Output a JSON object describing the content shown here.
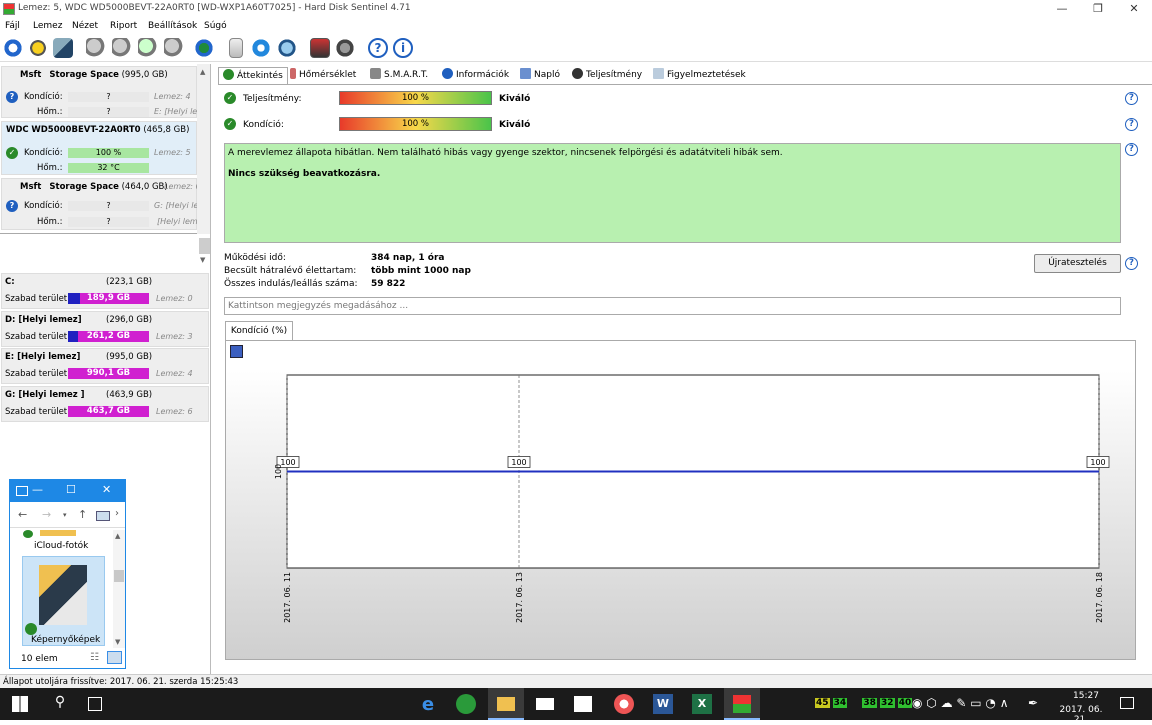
{
  "window": {
    "title": "Lemez: 5, WDC WD5000BEVT-22A0RT0 [WD-WXP1A60T7025]  -  Hard Disk Sentinel 4.71"
  },
  "menu": [
    "Fájl",
    "Lemez",
    "Nézet",
    "Riport",
    "Beállítások",
    "Súgó"
  ],
  "disks": [
    {
      "vendor": "Msft",
      "model": "Storage Space",
      "size": "(995,0 GB)",
      "cond_label": "Kondíció:",
      "cond_val": "?",
      "temp_label": "Hőm.:",
      "temp_val": "?",
      "ghost1": "Lemez: 4",
      "ghost2": "E: [Helyi le"
    },
    {
      "vendor": "WDC",
      "model": "WD5000BEVT-22A0RT0",
      "size": "(465,8 GB)",
      "cond_label": "Kondíció:",
      "cond_val": "100 %",
      "temp_label": "Hőm.:",
      "temp_val": "32 °C",
      "ghost1": "Lemez: 5",
      "ghost2": ""
    },
    {
      "vendor": "Msft",
      "model": "Storage Space",
      "size": "(464,0 GB)",
      "cond_label": "Kondíció:",
      "cond_val": "?",
      "temp_label": "Hőm.:",
      "temp_val": "?",
      "ghost0": "Lemez: 6",
      "ghost1": "G: [Helyi le",
      "ghost2": "[Helyi lem"
    }
  ],
  "partitions": [
    {
      "name": "C:",
      "size": "(223,1 GB)",
      "free_label": "Szabad terület",
      "free": "189,9 GB",
      "disk": "Lemez: 0",
      "used_fraction": 0.15
    },
    {
      "name": "D: [Helyi lemez]",
      "size": "(296,0 GB)",
      "free_label": "Szabad terület",
      "free": "261,2 GB",
      "disk": "Lemez: 3",
      "used_fraction": 0.12
    },
    {
      "name": "E: [Helyi lemez]",
      "size": "(995,0 GB)",
      "free_label": "Szabad terület",
      "free": "990,1 GB",
      "disk": "Lemez: 4",
      "used_fraction": 0.0
    },
    {
      "name": "G: [Helyi lemez ]",
      "size": "(463,9 GB)",
      "free_label": "Szabad terület",
      "free": "463,7 GB",
      "disk": "Lemez: 6",
      "used_fraction": 0.0
    }
  ],
  "explorer": {
    "item1": "iCloud-fotók",
    "item2": "Képernyőképek",
    "count": "10 elem"
  },
  "tabs": [
    "Áttekintés",
    "Hőmérséklet",
    "S.M.A.R.T.",
    "Információk",
    "Napló",
    "Teljesítmény",
    "Figyelmeztetések"
  ],
  "overview": {
    "perf_label": "Teljesítmény:",
    "perf_value": "100 %",
    "perf_fraction": 1.0,
    "perf_rating": "Kiváló",
    "health_label": "Kondíció:",
    "health_value": "100 %",
    "health_fraction": 1.0,
    "health_rating": "Kiváló",
    "status_text": "A merevlemez állapota hibátlan. Nem található hibás vagy gyenge szektor, nincsenek felpörgési és adatátviteli hibák sem.",
    "status_bold": "Nincs szükség beavatkozásra.",
    "uptime_label": "Működési idő:",
    "uptime_value": "384 nap, 1 óra",
    "life_label": "Becsült hátralévő élettartam:",
    "life_value": "több mint 1000 nap",
    "starts_label": "Összes indulás/leállás száma:",
    "starts_value": "59 822",
    "retest_button": "Újratesztelés",
    "note_placeholder": "Kattintson megjegyzés megadásához ..."
  },
  "chart_tab": "Kondíció  (%)",
  "chart_data": {
    "type": "line",
    "x": [
      "2017. 06. 11",
      "2017. 06. 13",
      "2017. 06. 18"
    ],
    "series": [
      {
        "values": [
          100,
          100,
          100
        ]
      }
    ],
    "data_labels": [
      "100",
      "100",
      "100"
    ],
    "ylabel_left": "100",
    "color": "#2030c0"
  },
  "statusbar": "Állapot utoljára frissítve: 2017. 06. 21. szerda 15:25:43",
  "taskbar": {
    "time": "15:27",
    "date": "2017. 06. 21.",
    "tray_numbers": [
      "45",
      "34",
      "38",
      "32",
      "40"
    ]
  }
}
